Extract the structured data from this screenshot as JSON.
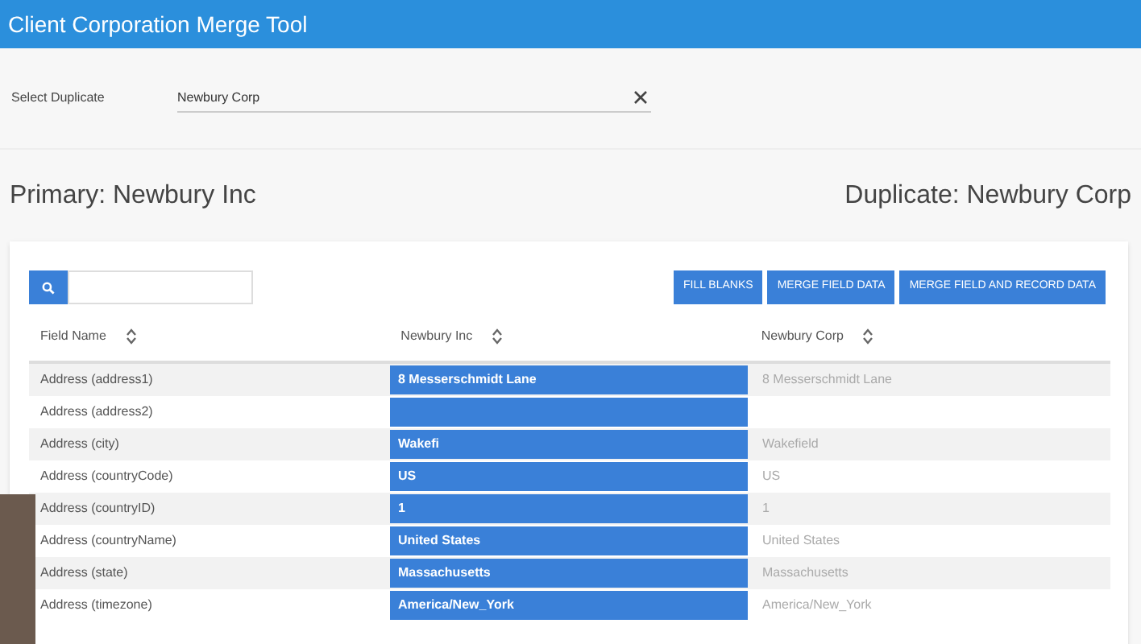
{
  "window": {
    "title": "Client Corporation Merge Tool"
  },
  "select_duplicate": {
    "label": "Select Duplicate",
    "value": "Newbury Corp"
  },
  "primary_title": "Primary: Newbury Inc",
  "duplicate_title": "Duplicate: Newbury Corp",
  "buttons": [
    "FILL BLANKS",
    "MERGE FIELD DATA",
    "MERGE FIELD AND RECORD DATA"
  ],
  "table": {
    "columns": [
      "Field Name",
      "Newbury Inc",
      "Newbury Corp"
    ],
    "rows": [
      {
        "field": "Address (address1)",
        "primary": "8 Messerschmidt Lane",
        "duplicate": "8 Messerschmidt Lane",
        "selected": true
      },
      {
        "field": "Address (address2)",
        "selected": true
      },
      {
        "field": "Address (city)",
        "primary": "Wakefi",
        "duplicate": "Wakefield",
        "selected": true
      },
      {
        "field": "Address (countryCode)",
        "primary": "US",
        "duplicate": "US",
        "selected": true
      },
      {
        "field": "Address (countryID)",
        "primary": "1",
        "duplicate": "1",
        "selected": true
      },
      {
        "field": "Address (countryName)",
        "primary": "United States",
        "duplicate": "United States",
        "selected": true
      },
      {
        "field": "Address (state)",
        "primary": "Massachusetts",
        "duplicate": "Massachusetts",
        "selected": true
      },
      {
        "field": "Address (timezone)",
        "primary": "America/New_York",
        "duplicate": "America/New_York",
        "selected": true
      }
    ]
  }
}
